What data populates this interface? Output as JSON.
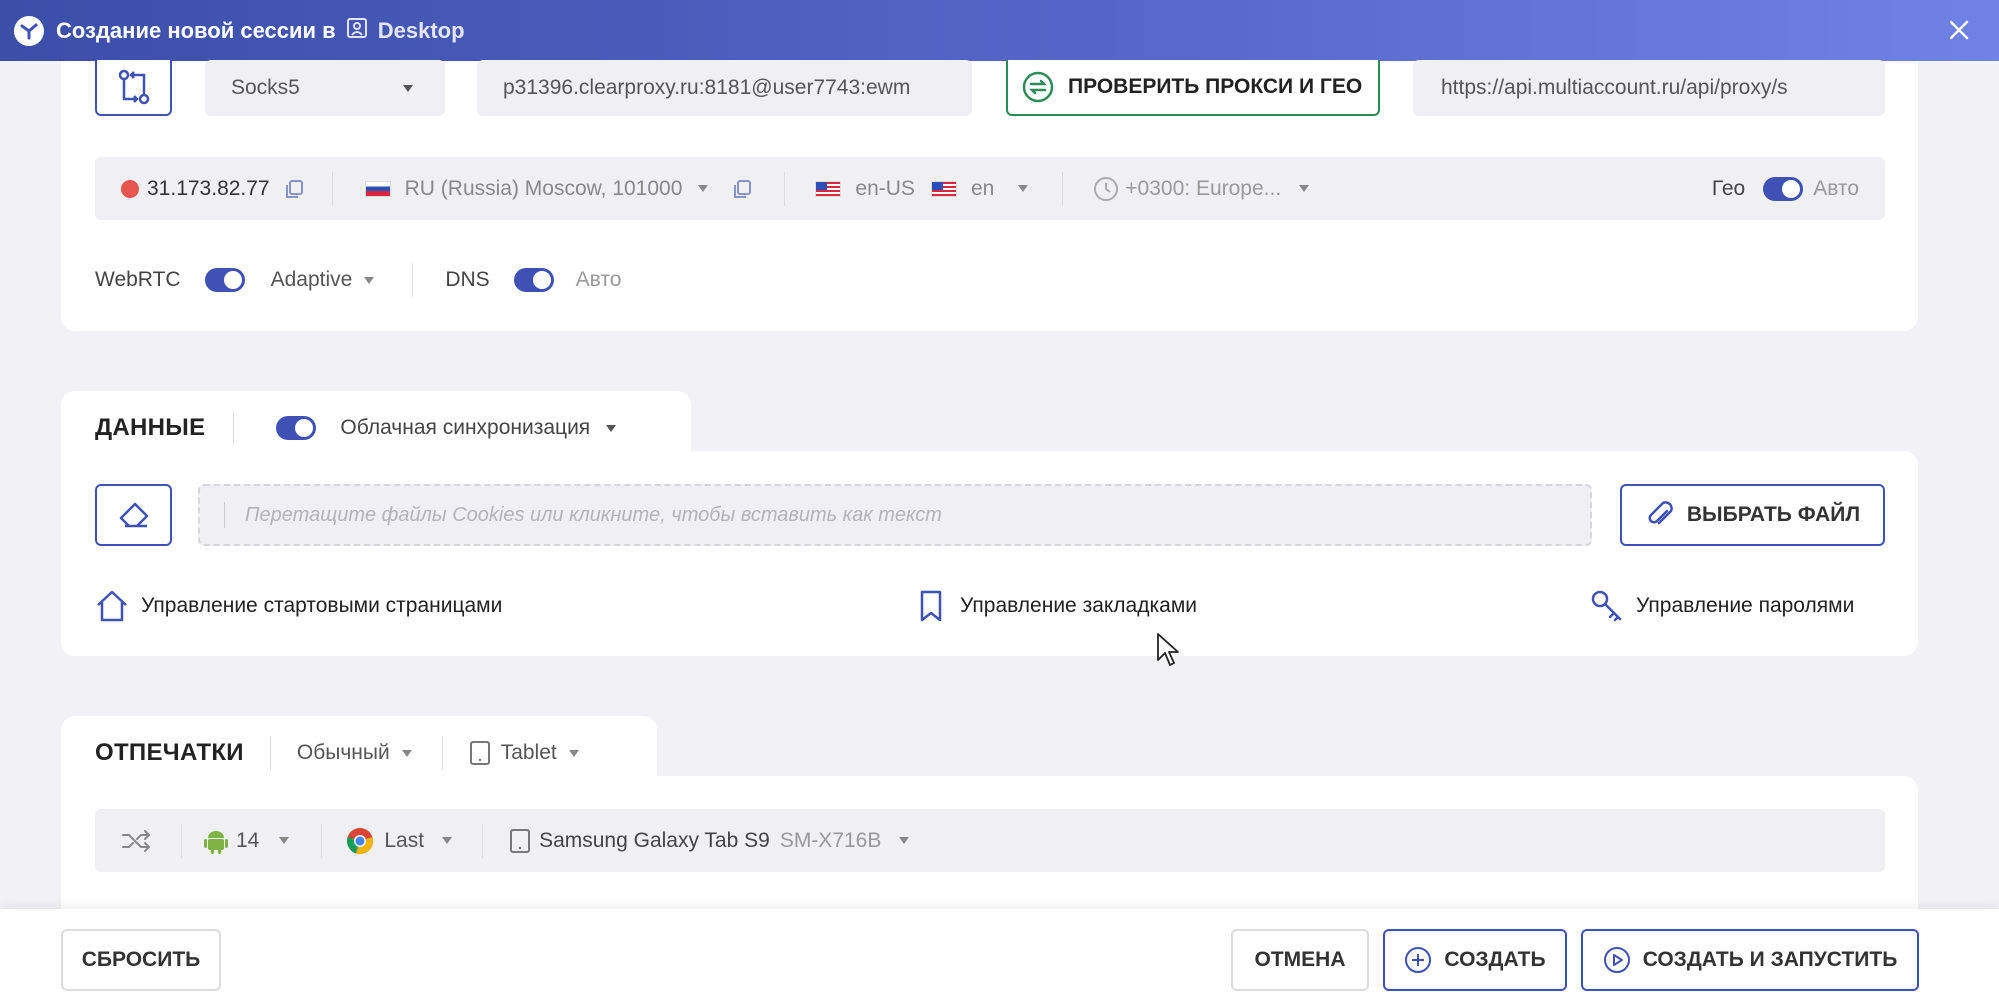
{
  "window": {
    "title": "Создание новой сессии в",
    "workspace": "Desktop",
    "close_icon": "close-icon"
  },
  "proxy": {
    "type": "Socks5",
    "address": "p31396.clearproxy.ru:8181@user7743:ewm",
    "check_button": "ПРОВЕРИТЬ ПРОКСИ И ГЕО",
    "api_url": "https://api.multiaccount.ru/api/proxy/s"
  },
  "geo": {
    "ip": "31.173.82.77",
    "status_color": "#e8574f",
    "location": "RU (Russia) Moscow, 101000",
    "lang1": "en-US",
    "lang2": "en",
    "timezone": "+0300: Europe...",
    "geo_label": "Гео",
    "auto_label": "Авто"
  },
  "network": {
    "webrtc_label": "WebRTC",
    "webrtc_mode": "Adaptive",
    "dns_label": "DNS",
    "dns_mode": "Авто"
  },
  "data_section": {
    "title": "ДАННЫЕ",
    "sync_label": "Облачная синхронизация",
    "drop_placeholder": "Перетащите файлы Cookies или кликните, чтобы вставить как текст",
    "choose_file": "ВЫБРАТЬ ФАЙЛ",
    "start_pages": "Управление стартовыми страницами",
    "bookmarks": "Управление закладками",
    "passwords": "Управление паролями"
  },
  "fingerprint": {
    "title": "ОТПЕЧАТКИ",
    "mode": "Обычный",
    "device_type": "Tablet",
    "os_version": "14",
    "browser_version": "Last",
    "device": "Samsung Galaxy Tab S9",
    "model": "SM-X716B"
  },
  "footer": {
    "reset": "СБРОСИТЬ",
    "cancel": "ОТМЕНА",
    "create": "СОЗДАТЬ",
    "create_and_run": "СОЗДАТЬ И ЗАПУСТИТЬ"
  },
  "colors": {
    "accent": "#3f51b5",
    "green": "#2e8b57",
    "titlebar": "#4a5bc0"
  }
}
